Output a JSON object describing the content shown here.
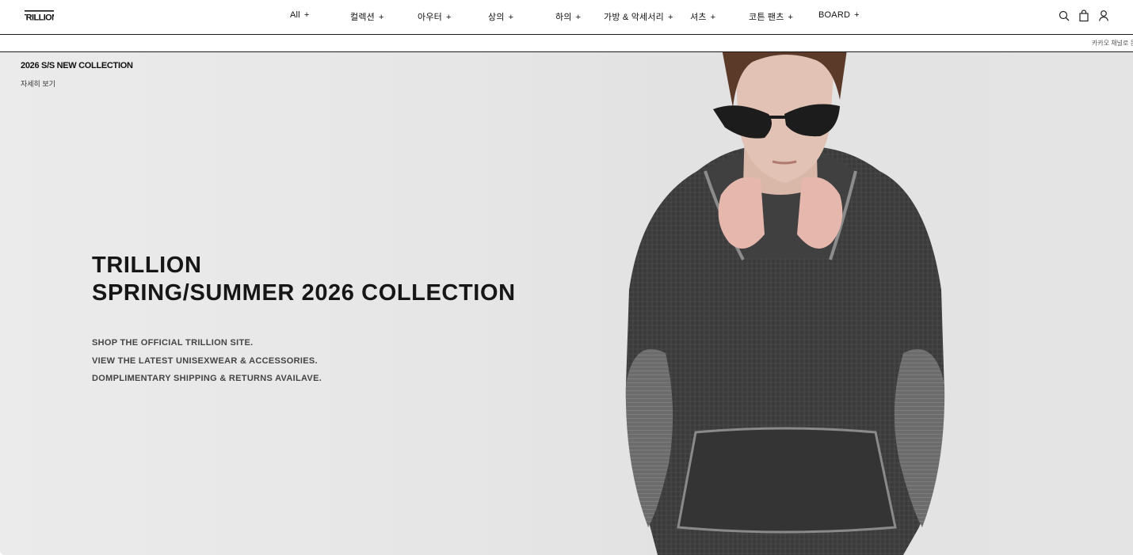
{
  "brand": {
    "logo_text": "TRILLION"
  },
  "nav": {
    "items": [
      {
        "label": "All",
        "plus": "+"
      },
      {
        "label": "컬렉션",
        "plus": "+"
      },
      {
        "label": "아우터",
        "plus": "+"
      },
      {
        "label": "상의",
        "plus": "+"
      },
      {
        "label": "하의",
        "plus": "+"
      },
      {
        "label": "가방 & 악세서리",
        "plus": "+"
      },
      {
        "label": "셔츠",
        "plus": "+"
      },
      {
        "label": "코튼 팬츠",
        "plus": "+"
      },
      {
        "label": "BOARD",
        "plus": "+"
      }
    ]
  },
  "header_icons": [
    "search-icon",
    "bag-icon",
    "user-icon"
  ],
  "ticker": {
    "text": "카카오 채널로 문"
  },
  "hero": {
    "tag": "2026 S/S NEW COLLECTION",
    "more": "자세히 보기",
    "title_line1": "TRILLION",
    "title_line2": "SPRING/SUMMER 2026 COLLECTION",
    "line1": "SHOP THE OFFICIAL TRILLION SITE.",
    "line2": "VIEW THE LATEST UNISEXWEAR & ACCESSORIES.",
    "line3": "DOMPLIMENTARY SHIPPING & RETURNS AVAILAVE."
  },
  "colors": {
    "border": "#1a1a1a",
    "hero_bg": "#e6e6e6",
    "text": "#111111"
  }
}
